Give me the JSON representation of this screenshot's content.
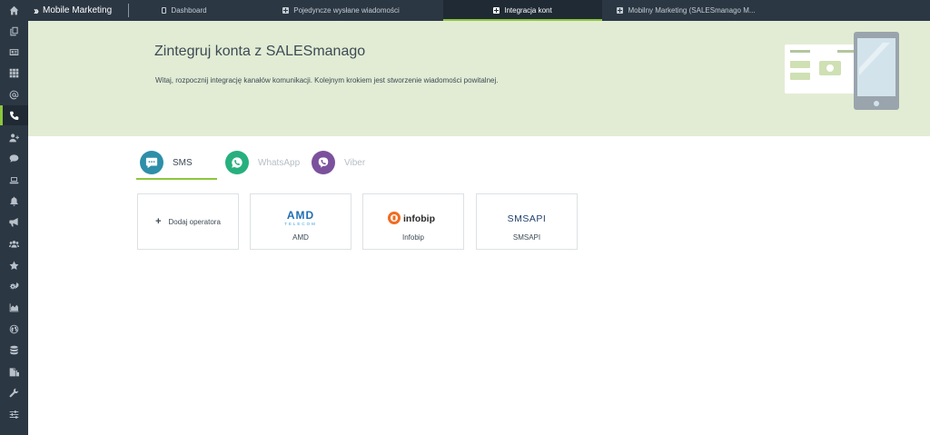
{
  "sidebar": {
    "items": [
      {
        "icon": "home-icon"
      },
      {
        "icon": "copy-icon"
      },
      {
        "icon": "contact-card-icon"
      },
      {
        "icon": "grid-icon"
      },
      {
        "icon": "at-icon"
      },
      {
        "icon": "phone-icon",
        "active": true
      },
      {
        "icon": "add-user-icon"
      },
      {
        "icon": "chat-icon"
      },
      {
        "icon": "laptop-icon"
      },
      {
        "icon": "bell-icon"
      },
      {
        "icon": "megaphone-icon"
      },
      {
        "icon": "users-icon"
      },
      {
        "icon": "star-icon"
      },
      {
        "icon": "cogs-icon"
      },
      {
        "icon": "area-chart-icon"
      },
      {
        "icon": "globe-icon"
      },
      {
        "icon": "database-icon"
      },
      {
        "icon": "files-icon"
      },
      {
        "icon": "wrench-icon"
      },
      {
        "icon": "sliders-icon"
      }
    ]
  },
  "topbar": {
    "brand": "Mobile Marketing",
    "tabs": [
      {
        "label": "Dashboard",
        "icon": "document-icon"
      },
      {
        "label": "Pojedyncze wysłane wiadomości",
        "icon": "plus-square-icon"
      },
      {
        "label": "Integracja kont",
        "icon": "plus-square-icon",
        "active": true
      },
      {
        "label": "Mobilny Marketing (SALESmanago M...",
        "icon": "plus-square-icon"
      }
    ]
  },
  "hero": {
    "title": "Zintegruj konta z SALESmanago",
    "description": "Witaj, rozpocznij integrację kanałów komunikacji. Kolejnym krokiem jest stworzenie wiadomości powitalnej."
  },
  "channels": [
    {
      "label": "SMS",
      "active": true,
      "color": "#2e8fa8",
      "icon": "sms-bubble-icon"
    },
    {
      "label": "WhatsApp",
      "active": false,
      "color": "#27b07e",
      "icon": "whatsapp-icon"
    },
    {
      "label": "Viber",
      "active": false,
      "color": "#7b519d",
      "icon": "viber-icon"
    }
  ],
  "operators": {
    "add_label": "Dodaj operatora",
    "items": [
      {
        "name": "AMD",
        "logo_text": "AMD",
        "logo_subtext": "TELECOM"
      },
      {
        "name": "Infobip",
        "logo_text": "infobip"
      },
      {
        "name": "SMSAPI",
        "logo_text": "SMSAPI"
      }
    ]
  },
  "colors": {
    "sidebar_bg": "#2b3743",
    "hero_bg": "#e2ecd4",
    "accent": "#8cc63f"
  }
}
